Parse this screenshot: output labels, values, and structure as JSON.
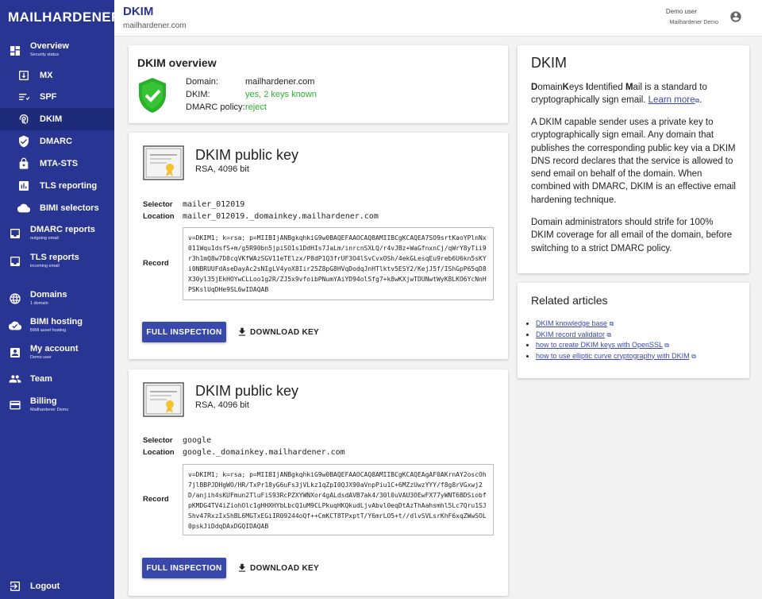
{
  "brand": "MAILHARDENER",
  "nav": [
    {
      "label": "Overview",
      "sub": "Security status",
      "icon": "dashboard-icon"
    },
    {
      "label": "MX",
      "sub": "",
      "icon": "mx-icon"
    },
    {
      "label": "SPF",
      "sub": "",
      "icon": "spf-icon"
    },
    {
      "label": "DKIM",
      "sub": "",
      "icon": "fingerprint-icon"
    },
    {
      "label": "DMARC",
      "sub": "",
      "icon": "shield-check-icon"
    },
    {
      "label": "MTA-STS",
      "sub": "",
      "icon": "lock-icon"
    },
    {
      "label": "TLS reporting",
      "sub": "",
      "icon": "report-icon"
    },
    {
      "label": "BIMI selectors",
      "sub": "",
      "icon": "cloud-icon"
    },
    {
      "label": "DMARC reports",
      "sub": "outgoing email",
      "icon": "inbox-icon"
    },
    {
      "label": "TLS reports",
      "sub": "incoming email",
      "icon": "inbox-icon"
    },
    {
      "label": "Domains",
      "sub": "1 domain",
      "icon": "globe-icon"
    },
    {
      "label": "BIMI hosting",
      "sub": "BIMI asset hosting",
      "icon": "cloud-check-icon"
    },
    {
      "label": "My account",
      "sub": "Demo user",
      "icon": "account-box-icon"
    },
    {
      "label": "Team",
      "sub": "",
      "icon": "team-icon"
    },
    {
      "label": "Billing",
      "sub": "Mailhardener Demo",
      "icon": "credit-card-icon"
    },
    {
      "label": "Logout",
      "sub": "",
      "icon": "logout-icon"
    }
  ],
  "header": {
    "title": "DKIM",
    "subtitle": "mailhardener.com",
    "user_name": "Demo user",
    "user_org": "Mailhardener Demo"
  },
  "overview": {
    "title": "DKIM overview",
    "domain_label": "Domain:",
    "domain_value": "mailhardener.com",
    "dkim_label": "DKIM:",
    "dkim_value": "yes, 2 keys known",
    "dmarc_label": "DMARC policy:",
    "dmarc_value": "reject",
    "status_color": "#2bb02b"
  },
  "keys": [
    {
      "title": "DKIM public key",
      "subtitle": "RSA, 4096 bit",
      "selector_label": "Selector",
      "selector": "mailer_012019",
      "location_label": "Location",
      "location": "mailer_012019._domainkey.mailhardener.com",
      "record_label": "Record",
      "record": "v=DKIM1; k=rsa; p=MIIBIjANBgkqhkiG9w0BAQEFAAOCAQ8AMIIBCgKCAQEA7SO9srtKaoYPlnNx011Wqu1dsfS+m/g5R90bn5jpiSO1s1DdHIs7JaLm/inrcnSXLQ/r4vJBz+WaGfnxnCj/qWrY8yTii9r3h1mQ8w7D8cqVKfWAzSGV11eTElzx/P8dP1Q3frUF3O4lSvCvxOSh/4ekGLesqEu9reb6U6kn5sKYi0NBRUUFdAseDayAc2sNIgLV4yoX8Iir25Z8pG8HVqDodqJnHTlktv5ESY2/KejJ5f/IShGpP65qD8X30yl35jEkHOYwCLLoo1g2R/ZJ5x9vfoibPNumYAiYD94olSfg7+k8wKXjwTDUNwtWyK8LKO6YcNnHPSKslUqDHe9SL6wIDAQAB",
      "full_inspection_label": "FULL INSPECTION",
      "download_label": "DOWNLOAD KEY"
    },
    {
      "title": "DKIM public key",
      "subtitle": "RSA, 4096 bit",
      "selector_label": "Selector",
      "selector": "google",
      "location_label": "Location",
      "location": "google._domainkey.mailhardener.com",
      "record_label": "Record",
      "record": "v=DKIM1; k=rsa; p=MIIBIjANBgkqhkiG9w0BAQEFAAOCAQ8AMIIBCgKCAQEAgAF0AKrnAY2oscOh7jlBBPJDHgWO/HR/TxPr18yG6uFs3jVLkz1qZpI0QJX90aVnpPiu1C+6MZzUwzYYY/f8g8rVGxwj2D/anjih4sKUFmun2TluFiS93RcPZXYWNXor4gALdsdAVB7ak4/30l0uVAU3OEwFX77yWNT6BDSiobfpKMDG4TV4iZiohOlc1gHHXHYbLbcQ1uM9CLPkuqHKQkudLjvAbvl0eqDtAzThAahsmhl5Lc7Qru1SJShv47RxzIxShBL6MGTxEGiIR09244oQf++CmKCT8TPxptT/Y6mrLO5+t//dlvSVLsrKhF6xqZWwSOL0pskJiDdqDAxDGQIDAQAB",
      "full_inspection_label": "FULL INSPECTION",
      "download_label": "DOWNLOAD KEY"
    }
  ],
  "about": {
    "title": "DKIM",
    "p1_d": "D",
    "p1_omain": "omain",
    "p1_k": "K",
    "p1_eys": "eys ",
    "p1_i": "I",
    "p1_dentified": "dentified ",
    "p1_m": "M",
    "p1_rest": "ail is a standard to cryptographically sign email. ",
    "learn_more": "Learn more",
    "p1_end": ".",
    "p2": "A DKIM capable sender uses a private key to cryptographically sign email. Any domain that publishes the corresponding public key via a DKIM DNS record declares that the service is allowed to send email on behalf of the domain. When combined with DMARC, DKIM is an effective email hardening technique.",
    "p3": "Domain administrators should strife for 100% DKIM coverage for all email of the domain, before switching to a strict DMARC policy."
  },
  "related": {
    "title": "Related articles",
    "links": [
      "DKIM knowledge base",
      "DKIM record validator",
      "how to create DKIM keys with OpenSSL",
      "how to use elliptic curve cryptography with DKIM"
    ]
  },
  "colors": {
    "sidebar": "#283593",
    "accent": "#3949ab",
    "ok": "#2bb02b"
  }
}
